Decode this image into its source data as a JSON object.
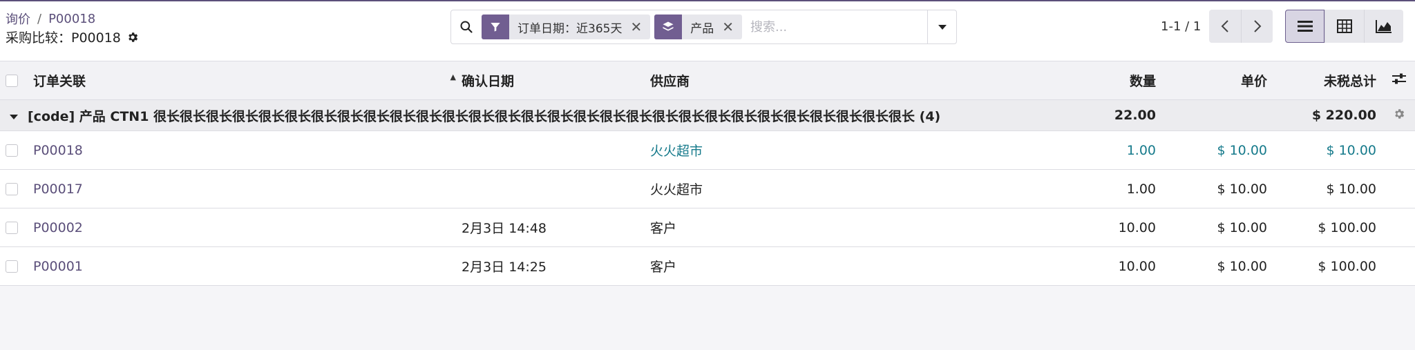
{
  "breadcrumb": {
    "parent": "询价",
    "separator": "/",
    "current": "P00018"
  },
  "page_title": "采购比较：P00018",
  "search": {
    "facets": [
      {
        "label": "订单日期：近365天",
        "icon": "filter-icon"
      },
      {
        "label": "产品",
        "icon": "layers-icon"
      }
    ],
    "placeholder": "搜索..."
  },
  "pager": {
    "value": "1-1 / 1"
  },
  "table": {
    "headers": {
      "order": "订单关联",
      "date": "确认日期",
      "vendor": "供应商",
      "qty": "数量",
      "price": "单价",
      "subtotal": "未税总计"
    },
    "group": {
      "label": "[code] 产品 CTN1 很长很长很长很长很长很长很长很长很长很长很长很长很长很长很长很长很长很长很长很长很长很长很长很长很长很长很长很长很长 (4)",
      "qty": "22.00",
      "subtotal": "$ 220.00"
    },
    "rows": [
      {
        "order": "P00018",
        "date": "",
        "vendor": "火火超市",
        "qty": "1.00",
        "price": "$ 10.00",
        "subtotal": "$ 10.00",
        "highlight": true
      },
      {
        "order": "P00017",
        "date": "",
        "vendor": "火火超市",
        "qty": "1.00",
        "price": "$ 10.00",
        "subtotal": "$ 10.00",
        "highlight": false
      },
      {
        "order": "P00002",
        "date": "2月3日 14:48",
        "vendor": "客户",
        "qty": "10.00",
        "price": "$ 10.00",
        "subtotal": "$ 100.00",
        "highlight": false
      },
      {
        "order": "P00001",
        "date": "2月3日 14:25",
        "vendor": "客户",
        "qty": "10.00",
        "price": "$ 10.00",
        "subtotal": "$ 100.00",
        "highlight": false
      }
    ]
  }
}
